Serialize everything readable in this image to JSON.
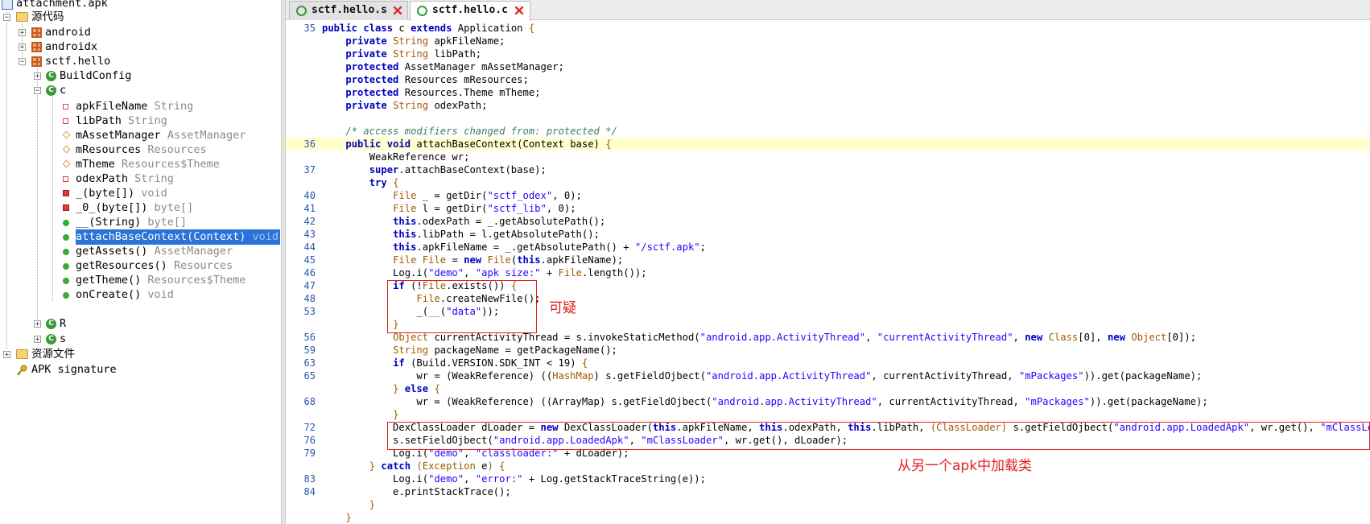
{
  "tree": {
    "root": {
      "label": "attachment.apk"
    },
    "source": {
      "label": "源代码"
    },
    "packages": [
      {
        "label": "android"
      },
      {
        "label": "androidx"
      },
      {
        "label": "sctf.hello"
      }
    ],
    "classes": [
      {
        "label": "BuildConfig"
      },
      {
        "label": "c"
      }
    ],
    "members": [
      {
        "label": "apkFileName",
        "type": "String",
        "kind": "private-field"
      },
      {
        "label": "libPath",
        "type": "String",
        "kind": "private-field"
      },
      {
        "label": "mAssetManager",
        "type": "AssetManager",
        "kind": "protected-field"
      },
      {
        "label": "mResources",
        "type": "Resources",
        "kind": "protected-field"
      },
      {
        "label": "mTheme",
        "type": "Resources$Theme",
        "kind": "protected-field"
      },
      {
        "label": "odexPath",
        "type": "String",
        "kind": "private-field"
      },
      {
        "label": "_(byte[])",
        "type": "void",
        "kind": "private-method"
      },
      {
        "label": "_0_(byte[])",
        "type": "byte[]",
        "kind": "private-method"
      },
      {
        "label": "__(String)",
        "type": "byte[]",
        "kind": "public-method"
      },
      {
        "label": "attachBaseContext(Context)",
        "type": "void",
        "kind": "public-method",
        "selected": true
      },
      {
        "label": "getAssets()",
        "type": "AssetManager",
        "kind": "public-method"
      },
      {
        "label": "getResources()",
        "type": "Resources",
        "kind": "public-method"
      },
      {
        "label": "getTheme()",
        "type": "Resources$Theme",
        "kind": "public-method"
      },
      {
        "label": "onCreate()",
        "type": "void",
        "kind": "public-method"
      }
    ],
    "after_classes": [
      {
        "label": "R"
      },
      {
        "label": "s"
      }
    ],
    "resources": {
      "label": "资源文件"
    },
    "signature": {
      "label": "APK signature"
    }
  },
  "tabs": [
    {
      "label": "sctf.hello.s",
      "active": false
    },
    {
      "label": "sctf.hello.c",
      "active": true
    }
  ],
  "annotations": {
    "suspicious": "可疑",
    "load_from_apk": "从另一个apk中加载类"
  },
  "code_lines": [
    {
      "n": "35",
      "hl": false,
      "t": [
        [
          "kw",
          "public class "
        ],
        [
          "",
          "c "
        ],
        [
          "kw",
          "extends "
        ],
        [
          "",
          "Application "
        ],
        [
          "ty",
          "{"
        ]
      ]
    },
    {
      "n": "",
      "hl": false,
      "t": [
        [
          "",
          "    "
        ],
        [
          "kw",
          "private "
        ],
        [
          "ty",
          "String "
        ],
        [
          "",
          "apkFileName;"
        ]
      ]
    },
    {
      "n": "",
      "hl": false,
      "t": [
        [
          "",
          "    "
        ],
        [
          "kw",
          "private "
        ],
        [
          "ty",
          "String "
        ],
        [
          "",
          "libPath;"
        ]
      ]
    },
    {
      "n": "",
      "hl": false,
      "t": [
        [
          "",
          "    "
        ],
        [
          "kw",
          "protected "
        ],
        [
          "",
          "AssetManager mAssetManager;"
        ]
      ]
    },
    {
      "n": "",
      "hl": false,
      "t": [
        [
          "",
          "    "
        ],
        [
          "kw",
          "protected "
        ],
        [
          "",
          "Resources mResources;"
        ]
      ]
    },
    {
      "n": "",
      "hl": false,
      "t": [
        [
          "",
          "    "
        ],
        [
          "kw",
          "protected "
        ],
        [
          "",
          "Resources.Theme mTheme;"
        ]
      ]
    },
    {
      "n": "",
      "hl": false,
      "t": [
        [
          "",
          "    "
        ],
        [
          "kw",
          "private "
        ],
        [
          "ty",
          "String "
        ],
        [
          "",
          "odexPath;"
        ]
      ]
    },
    {
      "n": "",
      "hl": false,
      "t": [
        [
          "",
          ""
        ]
      ]
    },
    {
      "n": "",
      "hl": false,
      "t": [
        [
          "",
          "    "
        ],
        [
          "cm",
          "/* access modifiers changed from: protected */"
        ]
      ]
    },
    {
      "n": "36",
      "hl": true,
      "t": [
        [
          "",
          "    "
        ],
        [
          "kw",
          "public void "
        ],
        [
          "",
          "attachBaseContext(Context base) "
        ],
        [
          "ty",
          "{"
        ]
      ]
    },
    {
      "n": "",
      "hl": false,
      "t": [
        [
          "",
          "        WeakReference wr;"
        ]
      ]
    },
    {
      "n": "37",
      "hl": false,
      "t": [
        [
          "",
          "        "
        ],
        [
          "kw",
          "super"
        ],
        [
          "",
          ".attachBaseContext(base);"
        ]
      ]
    },
    {
      "n": "",
      "hl": false,
      "t": [
        [
          "",
          "        "
        ],
        [
          "kw",
          "try "
        ],
        [
          "ty",
          "{"
        ]
      ]
    },
    {
      "n": "40",
      "hl": false,
      "t": [
        [
          "",
          "            "
        ],
        [
          "ty",
          "File "
        ],
        [
          "",
          "_ = getDir("
        ],
        [
          "str",
          "\"sctf_odex\""
        ],
        [
          "",
          ", 0);"
        ]
      ]
    },
    {
      "n": "41",
      "hl": false,
      "t": [
        [
          "",
          "            "
        ],
        [
          "ty",
          "File "
        ],
        [
          "",
          "l = getDir("
        ],
        [
          "str",
          "\"sctf_lib\""
        ],
        [
          "",
          ", 0);"
        ]
      ]
    },
    {
      "n": "42",
      "hl": false,
      "t": [
        [
          "",
          "            "
        ],
        [
          "kw",
          "this"
        ],
        [
          "",
          ".odexPath = _.getAbsolutePath();"
        ]
      ]
    },
    {
      "n": "43",
      "hl": false,
      "t": [
        [
          "",
          "            "
        ],
        [
          "kw",
          "this"
        ],
        [
          "",
          ".libPath = l.getAbsolutePath();"
        ]
      ]
    },
    {
      "n": "44",
      "hl": false,
      "t": [
        [
          "",
          "            "
        ],
        [
          "kw",
          "this"
        ],
        [
          "",
          ".apkFileName = _.getAbsolutePath() + "
        ],
        [
          "str",
          "\"/sctf.apk\""
        ],
        [
          "",
          ";"
        ]
      ]
    },
    {
      "n": "45",
      "hl": false,
      "t": [
        [
          "",
          "            "
        ],
        [
          "ty",
          "File File "
        ],
        [
          "",
          "= "
        ],
        [
          "kw",
          "new "
        ],
        [
          "ty",
          "File"
        ],
        [
          "",
          "("
        ],
        [
          "kw",
          "this"
        ],
        [
          "",
          ".apkFileName);"
        ]
      ]
    },
    {
      "n": "46",
      "hl": false,
      "t": [
        [
          "",
          "            Log.i("
        ],
        [
          "str",
          "\"demo\""
        ],
        [
          "",
          ", "
        ],
        [
          "str",
          "\"apk size:\""
        ],
        [
          "",
          " + "
        ],
        [
          "ty",
          "File"
        ],
        [
          "",
          ".length());"
        ]
      ]
    },
    {
      "n": "47",
      "hl": false,
      "t": [
        [
          "",
          "            "
        ],
        [
          "kw",
          "if "
        ],
        [
          "",
          "(!"
        ],
        [
          "ty",
          "File"
        ],
        [
          "",
          ".exists()) "
        ],
        [
          "ty",
          "{"
        ]
      ]
    },
    {
      "n": "48",
      "hl": false,
      "t": [
        [
          "",
          "                "
        ],
        [
          "ty",
          "File"
        ],
        [
          "",
          ".createNewFile();"
        ]
      ]
    },
    {
      "n": "53",
      "hl": false,
      "t": [
        [
          "",
          "                _("
        ],
        [
          "ty",
          "__"
        ],
        [
          "",
          "("
        ],
        [
          "str",
          "\"data\""
        ],
        [
          "",
          "));"
        ]
      ]
    },
    {
      "n": "",
      "hl": false,
      "t": [
        [
          "",
          "            "
        ],
        [
          "ty",
          "}"
        ]
      ]
    },
    {
      "n": "56",
      "hl": false,
      "t": [
        [
          "",
          "            "
        ],
        [
          "ty",
          "Object "
        ],
        [
          "",
          "currentActivityThread = s.invokeStaticMethod("
        ],
        [
          "str",
          "\"android.app.ActivityThread\""
        ],
        [
          "",
          ", "
        ],
        [
          "str",
          "\"currentActivityThread\""
        ],
        [
          "",
          ", "
        ],
        [
          "kw",
          "new "
        ],
        [
          "ty",
          "Class"
        ],
        [
          "",
          "[0], "
        ],
        [
          "kw",
          "new "
        ],
        [
          "ty",
          "Object"
        ],
        [
          "",
          "[0]);"
        ]
      ]
    },
    {
      "n": "59",
      "hl": false,
      "t": [
        [
          "",
          "            "
        ],
        [
          "ty",
          "String "
        ],
        [
          "",
          "packageName = getPackageName();"
        ]
      ]
    },
    {
      "n": "63",
      "hl": false,
      "t": [
        [
          "",
          "            "
        ],
        [
          "kw",
          "if "
        ],
        [
          "",
          "(Build.VERSION.SDK_INT < 19) "
        ],
        [
          "ty",
          "{"
        ]
      ]
    },
    {
      "n": "65",
      "hl": false,
      "t": [
        [
          "",
          "                wr = (WeakReference) (("
        ],
        [
          "ty",
          "HashMap"
        ],
        [
          "",
          ") s.getFieldOjbect("
        ],
        [
          "str",
          "\"android.app.ActivityThread\""
        ],
        [
          "",
          ", currentActivityThread, "
        ],
        [
          "str",
          "\"mPackages\""
        ],
        [
          "",
          "))"
        ],
        [
          "",
          ".get(packageName);"
        ]
      ]
    },
    {
      "n": "",
      "hl": false,
      "t": [
        [
          "",
          "            "
        ],
        [
          "ty",
          "} "
        ],
        [
          "kw",
          "else "
        ],
        [
          "ty",
          "{"
        ]
      ]
    },
    {
      "n": "68",
      "hl": false,
      "t": [
        [
          "",
          "                wr = (WeakReference) ((ArrayMap) s.getFieldOjbect("
        ],
        [
          "str",
          "\"android.app.ActivityThread\""
        ],
        [
          "",
          ", currentActivityThread, "
        ],
        [
          "str",
          "\"mPackages\""
        ],
        [
          "",
          "))"
        ],
        [
          "",
          ".get(packageName);"
        ]
      ]
    },
    {
      "n": "",
      "hl": false,
      "t": [
        [
          "",
          "            "
        ],
        [
          "ty",
          "}"
        ]
      ]
    },
    {
      "n": "72",
      "hl": false,
      "t": [
        [
          "",
          "            DexClassLoader dLoader = "
        ],
        [
          "kw",
          "new "
        ],
        [
          "",
          "DexClassLoader("
        ],
        [
          "kw",
          "this"
        ],
        [
          "",
          ".apkFileName, "
        ],
        [
          "kw",
          "this"
        ],
        [
          "",
          ".odexPath, "
        ],
        [
          "kw",
          "this"
        ],
        [
          "",
          ".libPath, "
        ],
        [
          "ty",
          "(ClassLoader) "
        ],
        [
          "",
          "s.getFieldOjbect("
        ],
        [
          "str",
          "\"android.app.LoadedApk\""
        ],
        [
          "",
          ", wr.get(), "
        ],
        [
          "str",
          "\"mClassLoader\""
        ],
        [
          "",
          "));"
        ]
      ]
    },
    {
      "n": "76",
      "hl": false,
      "t": [
        [
          "",
          "            s.setFieldOjbect("
        ],
        [
          "str",
          "\"android.app.LoadedApk\""
        ],
        [
          "",
          ", "
        ],
        [
          "str",
          "\"mClassLoader\""
        ],
        [
          "",
          ", wr.get(), dLoader);"
        ]
      ]
    },
    {
      "n": "79",
      "hl": false,
      "t": [
        [
          "",
          "            Log.i("
        ],
        [
          "str",
          "\"demo\""
        ],
        [
          "",
          ", "
        ],
        [
          "str",
          "\"classloader:\""
        ],
        [
          "",
          " + dLoader);"
        ]
      ]
    },
    {
      "n": "",
      "hl": false,
      "t": [
        [
          "",
          "        "
        ],
        [
          "ty",
          "} "
        ],
        [
          "kw",
          "catch "
        ],
        [
          "ty",
          "(Exception "
        ],
        [
          "",
          "e"
        ],
        [
          "ty",
          ") {"
        ]
      ]
    },
    {
      "n": "83",
      "hl": false,
      "t": [
        [
          "",
          "            Log.i("
        ],
        [
          "str",
          "\"demo\""
        ],
        [
          "",
          ", "
        ],
        [
          "str",
          "\"error:\""
        ],
        [
          "",
          " + Log.getStackTraceString(e));"
        ]
      ]
    },
    {
      "n": "84",
      "hl": false,
      "t": [
        [
          "",
          "            e.printStackTrace();"
        ]
      ]
    },
    {
      "n": "",
      "hl": false,
      "t": [
        [
          "",
          "        "
        ],
        [
          "ty",
          "}"
        ]
      ]
    },
    {
      "n": "",
      "hl": false,
      "t": [
        [
          "",
          "    "
        ],
        [
          "ty",
          "}"
        ]
      ]
    }
  ]
}
